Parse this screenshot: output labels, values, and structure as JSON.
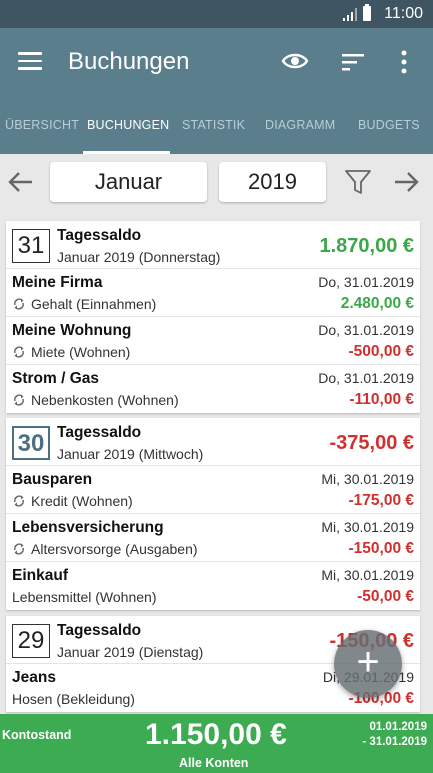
{
  "status": {
    "time": "11:00"
  },
  "appbar": {
    "title": "Buchungen"
  },
  "tabs": [
    {
      "label": "ÜBERSICHT"
    },
    {
      "label": "BUCHUNGEN"
    },
    {
      "label": "STATISTIK"
    },
    {
      "label": "DIAGRAMM"
    },
    {
      "label": "BUDGETS"
    }
  ],
  "datebar": {
    "month": "Januar",
    "year": "2019"
  },
  "days": [
    {
      "day": "31",
      "title": "Tagessaldo",
      "subtitle": "Januar 2019 (Donnerstag)",
      "total": "1.870,00 €",
      "entries": [
        {
          "name": "Meine Firma",
          "category": "Gehalt (Einnahmen)",
          "date": "Do, 31.01.2019",
          "amount": "2.480,00 €"
        },
        {
          "name": "Meine Wohnung",
          "category": "Miete (Wohnen)",
          "date": "Do, 31.01.2019",
          "amount": "-500,00 €"
        },
        {
          "name": "Strom / Gas",
          "category": "Nebenkosten (Wohnen)",
          "date": "Do, 31.01.2019",
          "amount": "-110,00 €"
        }
      ]
    },
    {
      "day": "30",
      "title": "Tagessaldo",
      "subtitle": "Januar 2019 (Mittwoch)",
      "total": "-375,00 €",
      "entries": [
        {
          "name": "Bausparen",
          "category": "Kredit (Wohnen)",
          "date": "Mi, 30.01.2019",
          "amount": "-175,00 €"
        },
        {
          "name": "Lebensversicherung",
          "category": "Altersvorsorge (Ausgaben)",
          "date": "Mi, 30.01.2019",
          "amount": "-150,00 €"
        },
        {
          "name": "Einkauf",
          "category": "Lebensmittel (Wohnen)",
          "date": "Mi, 30.01.2019",
          "amount": "-50,00 €"
        }
      ]
    },
    {
      "day": "29",
      "title": "Tagessaldo",
      "subtitle": "Januar 2019 (Dienstag)",
      "total": "-150,00 €",
      "entries": [
        {
          "name": "Jeans",
          "category": "Hosen (Bekleidung)",
          "date": "Di, 29.01.2019",
          "amount": "-100,00 €"
        }
      ]
    }
  ],
  "fab": {
    "label": "+"
  },
  "footer": {
    "label": "Kontostand",
    "amount": "1.150,00 €",
    "accounts": "Alle Konten",
    "range_start": "01.01.2019",
    "range_end": "- 31.01.2019"
  },
  "colors": {
    "positive": "#3aa84a",
    "negative": "#d32f2f",
    "appbar": "#5b7e8d",
    "footer": "#3dab52"
  }
}
